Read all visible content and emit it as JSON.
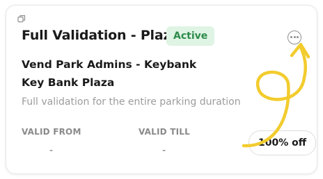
{
  "card": {
    "title": "Full Validation - Plaza",
    "status": "Active",
    "organization": "Vend Park Admins - Keybank",
    "location": "Key Bank Plaza",
    "description": "Full validation for the entire parking duration",
    "valid_from_label": "VALID FROM",
    "valid_from_value": "-",
    "valid_till_label": "VALID TILL",
    "valid_till_value": "-",
    "discount": "100% off"
  },
  "icons": {
    "copy": "copy-icon",
    "more": "more-options-icon"
  },
  "colors": {
    "status_badge_bg": "#dff4e4",
    "status_badge_text": "#2e8a4a",
    "annotation_arrow": "#f2cc2e"
  }
}
